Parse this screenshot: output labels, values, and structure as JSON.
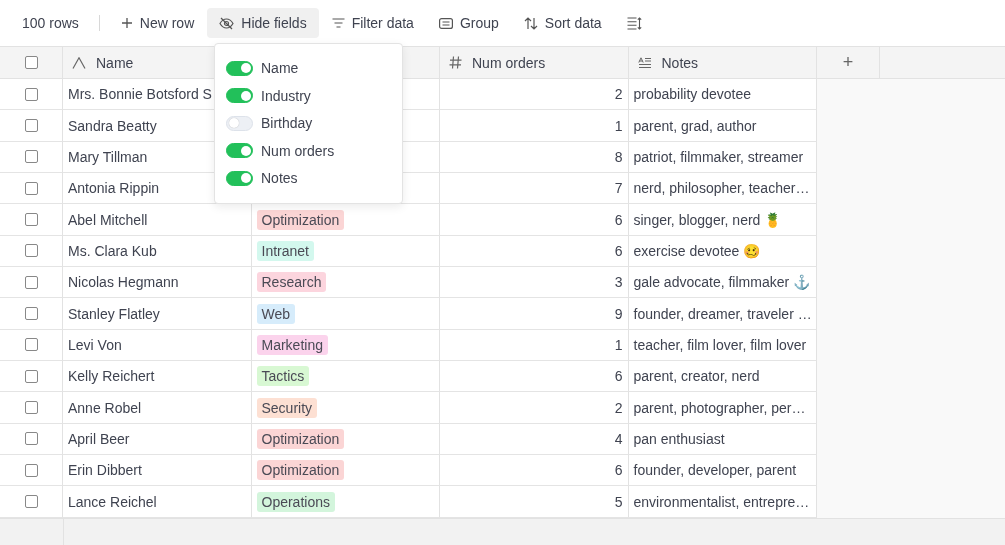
{
  "toolbar": {
    "row_count": "100 rows",
    "buttons": [
      {
        "kind": "new",
        "label": "New row",
        "selected": false
      },
      {
        "kind": "hide",
        "label": "Hide fields",
        "selected": true
      },
      {
        "kind": "filter",
        "label": "Filter data",
        "selected": false
      },
      {
        "kind": "group",
        "label": "Group",
        "selected": false
      },
      {
        "kind": "sort",
        "label": "Sort data",
        "selected": false
      },
      {
        "kind": "height",
        "selected": false
      }
    ]
  },
  "table": {
    "select_all_checked": false,
    "columns": [
      {
        "kind": "text",
        "label": "Name"
      },
      {
        "kind": "covered"
      },
      {
        "kind": "number",
        "label": "Num orders"
      },
      {
        "kind": "longtext",
        "label": "Notes"
      }
    ],
    "add_column": "+",
    "rows": [
      {
        "checked": false,
        "name": "Mrs. Bonnie Botsford S",
        "num_orders": "2",
        "notes": "probability devotee"
      },
      {
        "checked": false,
        "name": "Sandra Beatty",
        "num_orders": "1",
        "notes": "parent, grad, author"
      },
      {
        "checked": false,
        "name": "Mary Tillman",
        "num_orders": "8",
        "notes": "patriot, filmmaker, streamer"
      },
      {
        "checked": false,
        "name": "Antonia Rippin",
        "num_orders": "7",
        "notes": "nerd, philosopher, teacher…"
      },
      {
        "checked": false,
        "name": "Abel Mitchell",
        "industry": {
          "label": "Optimization",
          "color": "#fbd5d5"
        },
        "num_orders": "6",
        "notes": "singer, blogger, nerd 🍍"
      },
      {
        "checked": false,
        "name": "Ms. Clara Kub",
        "industry": {
          "label": "Intranet",
          "color": "#d3f8ee"
        },
        "num_orders": "6",
        "notes": "exercise devotee 🥴"
      },
      {
        "checked": false,
        "name": "Nicolas Hegmann",
        "industry": {
          "label": "Research",
          "color": "#fcd5de"
        },
        "num_orders": "3",
        "notes": "gale advocate, filmmaker ⚓"
      },
      {
        "checked": false,
        "name": "Stanley Flatley",
        "industry": {
          "label": "Web",
          "color": "#d6ecfb"
        },
        "num_orders": "9",
        "notes": "founder, dreamer, traveler …"
      },
      {
        "checked": false,
        "name": "Levi Von",
        "industry": {
          "label": "Marketing",
          "color": "#fbd3ec"
        },
        "num_orders": "1",
        "notes": "teacher, film lover, film lover"
      },
      {
        "checked": false,
        "name": "Kelly Reichert",
        "industry": {
          "label": "Tactics",
          "color": "#d8f8d3"
        },
        "num_orders": "6",
        "notes": "parent, creator, nerd"
      },
      {
        "checked": false,
        "name": "Anne Robel",
        "industry": {
          "label": "Security",
          "color": "#fde0d3"
        },
        "num_orders": "2",
        "notes": "parent, photographer, per…"
      },
      {
        "checked": false,
        "name": "April Beer",
        "industry": {
          "label": "Optimization",
          "color": "#fbd5d5"
        },
        "num_orders": "4",
        "notes": "pan enthusiast"
      },
      {
        "checked": false,
        "name": "Erin Dibbert",
        "industry": {
          "label": "Optimization",
          "color": "#fbd5d5"
        },
        "num_orders": "6",
        "notes": "founder, developer, parent"
      },
      {
        "checked": false,
        "name": "Lance Reichel",
        "industry": {
          "label": "Operations",
          "color": "#d3f5dc"
        },
        "num_orders": "5",
        "notes": "environmentalist, entrepre…"
      }
    ]
  },
  "hide_fields_menu": {
    "fields": [
      {
        "label": "Name",
        "on": true
      },
      {
        "label": "Industry",
        "on": true
      },
      {
        "label": "Birthday",
        "on": false
      },
      {
        "label": "Num orders",
        "on": true
      },
      {
        "label": "Notes",
        "on": true
      }
    ]
  }
}
